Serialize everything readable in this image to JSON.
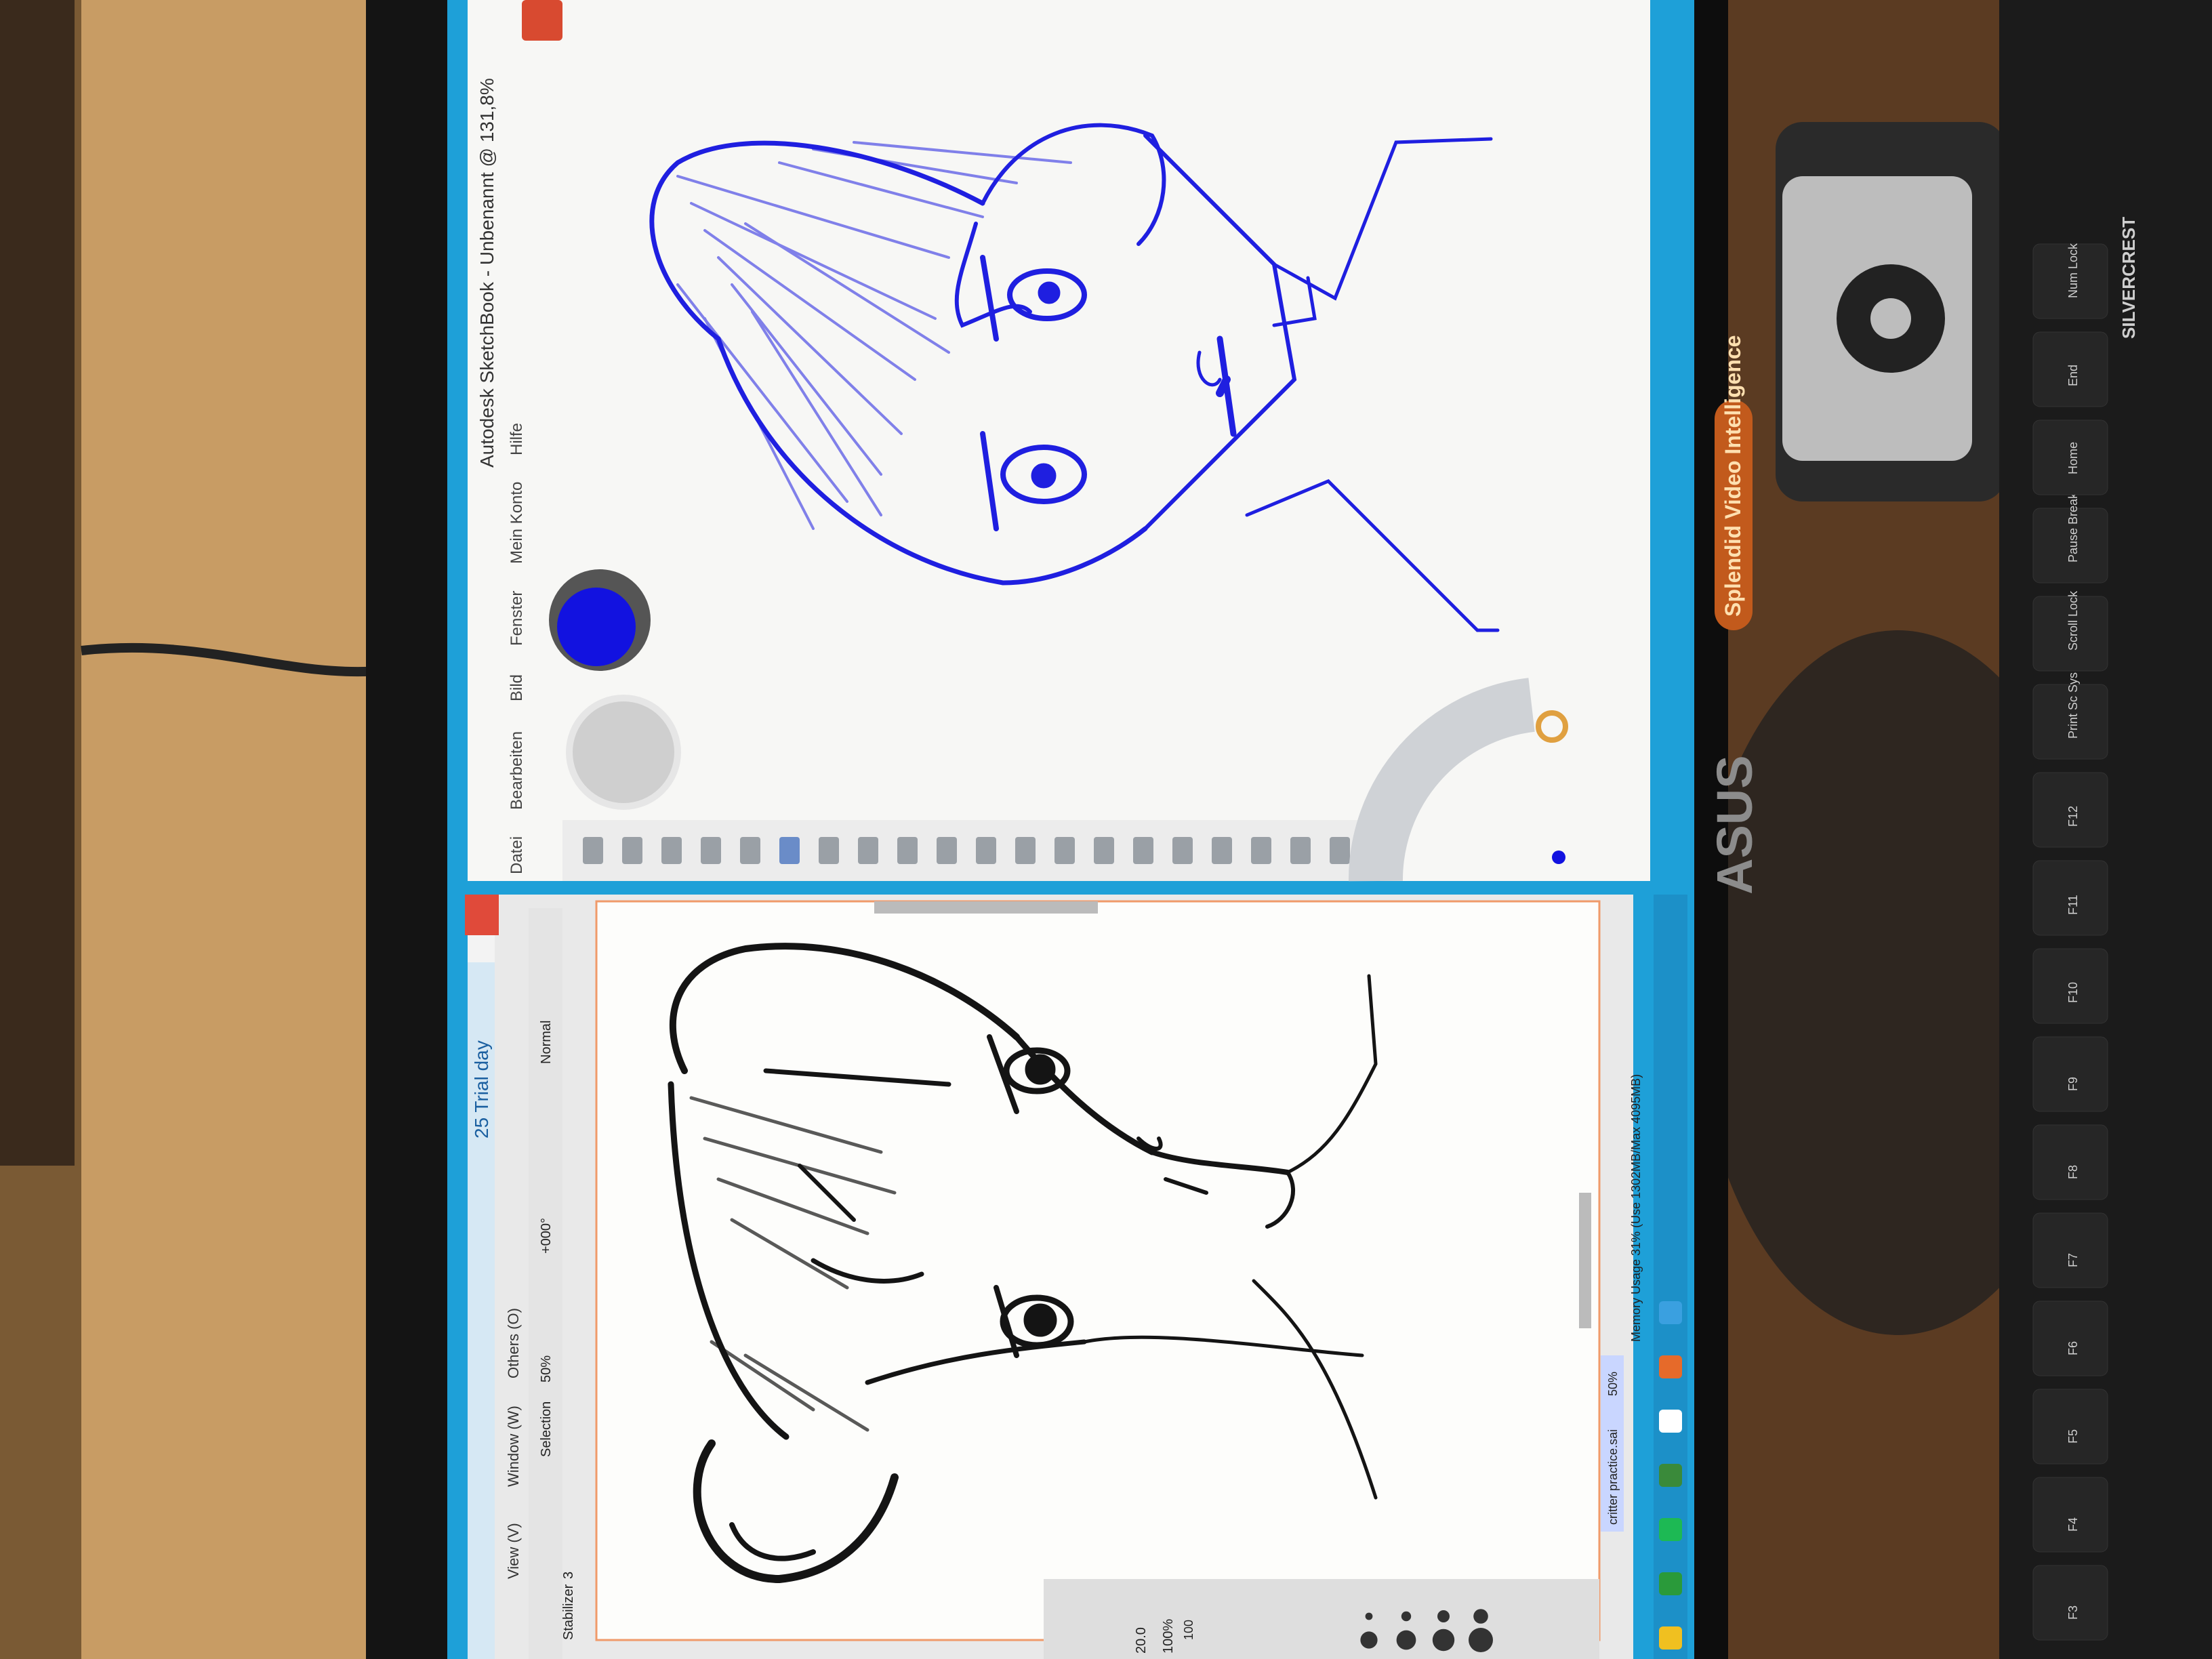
{
  "sketchbook": {
    "title": "Autodesk SketchBook - Unbenannt @ 131,8%",
    "menu": [
      "Datei",
      "Bearbeiten",
      "Bild",
      "Fenster",
      "Mein Konto",
      "Hilfe"
    ]
  },
  "sai": {
    "title": "25 Trial day",
    "menu": [
      "View (V)",
      "Window (W)",
      "Others (O)"
    ],
    "selection_label": "Selection",
    "zoom": "50%",
    "angle": "+000°",
    "blend_mode": "Normal",
    "stabilizer_label": "Stabilizer",
    "stabilizer_value": "3",
    "brush_size": "20.0",
    "opacity": "100%",
    "density": "100",
    "tab_file": "critter practice.sai",
    "tab_zoom": "50%",
    "status": "Memory Usage 31% (Use 1302MB/Max 4095MB)"
  },
  "monitor": {
    "brand": "ASUS",
    "badge": "Splendid Video Intelligence"
  },
  "keyboard": {
    "brand": "SILVERCREST",
    "keys": [
      "F3",
      "F4",
      "F5",
      "F6",
      "F7",
      "F8",
      "F9",
      "F10",
      "F11",
      "F12",
      "Print Sc Sys Rq",
      "Scroll Lock",
      "Pause Break",
      "Home",
      "End",
      "Num Lock"
    ]
  },
  "colors": {
    "sketchbook_ink": "#1a1adf",
    "sai_ink": "#141414",
    "taskbar": "#1e9ad6",
    "wall": "#c9a06a"
  }
}
